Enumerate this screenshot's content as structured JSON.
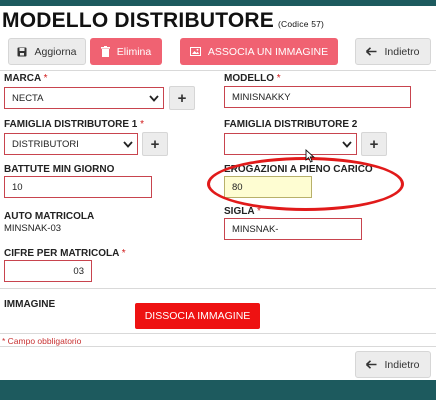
{
  "page": {
    "title": "MODELLO DISTRIBUTORE",
    "code": "(Codice 57)"
  },
  "toolbar": {
    "aggiorna_label": "Aggiorna",
    "elimina_label": "Elimina",
    "associa_label": "ASSOCIA UN IMMAGINE",
    "indietro_label": "Indietro"
  },
  "form": {
    "marca": {
      "label": "MARCA",
      "required": "*",
      "value": "NECTA"
    },
    "modello": {
      "label": "MODELLO",
      "required": "*",
      "value": "MINISNAKKY"
    },
    "famiglia1": {
      "label": "FAMIGLIA DISTRIBUTORE 1",
      "required": "*",
      "value": "DISTRIBUTORI"
    },
    "famiglia2": {
      "label": "FAMIGLIA DISTRIBUTORE 2",
      "value": ""
    },
    "battute": {
      "label": "BATTUTE MIN GIORNO",
      "value": "10"
    },
    "erogazioni": {
      "label": "EROGAZIONI A PIENO CARICO",
      "value": "80"
    },
    "auto_matricola": {
      "label": "AUTO MATRICOLA",
      "value": "MINSNAK-03"
    },
    "sigla": {
      "label": "SIGLA",
      "required": "*",
      "value": "MINSNAK-"
    },
    "cifre": {
      "label": "CIFRE PER MATRICOLA",
      "required": "*",
      "value": "03"
    },
    "plus": "+"
  },
  "immagine": {
    "label": "IMMAGINE",
    "dissocia_label": "DISSOCIA IMMAGINE"
  },
  "footer": {
    "note": "* Campo obbligatorio",
    "indietro_label": "Indietro"
  },
  "icons": {
    "save": "floppy-icon",
    "delete": "trash-icon",
    "image": "image-icon",
    "back": "arrow-left-icon",
    "dropdown": "chevron-down-icon",
    "add": "plus-icon"
  },
  "colors": {
    "header_bar": "#1d5a5e",
    "pink_button": "#f06272",
    "red_button": "#ee1212",
    "highlight_ellipse": "#e11a1a",
    "highlight_field": "#fefdd2"
  }
}
